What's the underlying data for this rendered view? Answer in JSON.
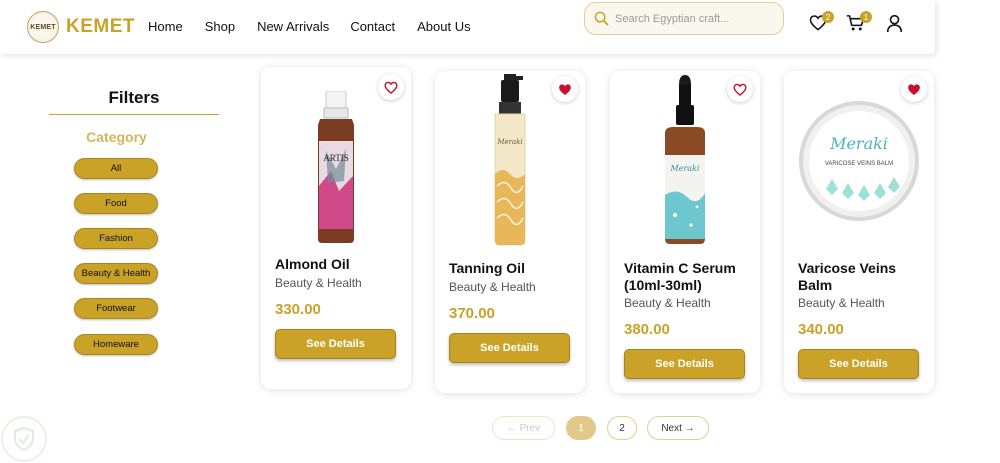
{
  "header": {
    "brand": "KEMET",
    "seal_text": "KEMET",
    "nav": [
      "Home",
      "Shop",
      "New Arrivals",
      "Contact",
      "About Us"
    ],
    "search_placeholder": "Search Egyptian craft...",
    "wishlist_count": "2",
    "cart_count": "1"
  },
  "filters": {
    "title": "Filters",
    "category_title": "Category",
    "categories": [
      "All",
      "Food",
      "Fashion",
      "Beauty & Health",
      "Footwear",
      "Homeware"
    ]
  },
  "products": [
    {
      "name": "Almond Oil",
      "category": "Beauty & Health",
      "price": "330.00",
      "button": "See Details",
      "favorite": false,
      "label_text": "ARTIS"
    },
    {
      "name": "Tanning Oil",
      "category": "Beauty & Health",
      "price": "370.00",
      "button": "See Details",
      "favorite": true,
      "label_text": "Meraki"
    },
    {
      "name": "Vitamin C Serum (10ml-30ml)",
      "category": "Beauty & Health",
      "price": "380.00",
      "button": "See Details",
      "favorite": false,
      "label_text": "Meraki"
    },
    {
      "name": "Varicose Veins Balm",
      "category": "Beauty & Health",
      "price": "340.00",
      "button": "See Details",
      "favorite": true,
      "label_text": "VARICOSE VEINS BALM"
    }
  ],
  "pagination": {
    "prev": "← Prev",
    "pages": [
      "1",
      "2"
    ],
    "current": "1",
    "next": "Next →"
  },
  "colors": {
    "accent": "#c9a227",
    "favorite_active": "#c8102e"
  },
  "icons": [
    "search-icon",
    "heart-icon",
    "cart-icon",
    "user-icon"
  ]
}
